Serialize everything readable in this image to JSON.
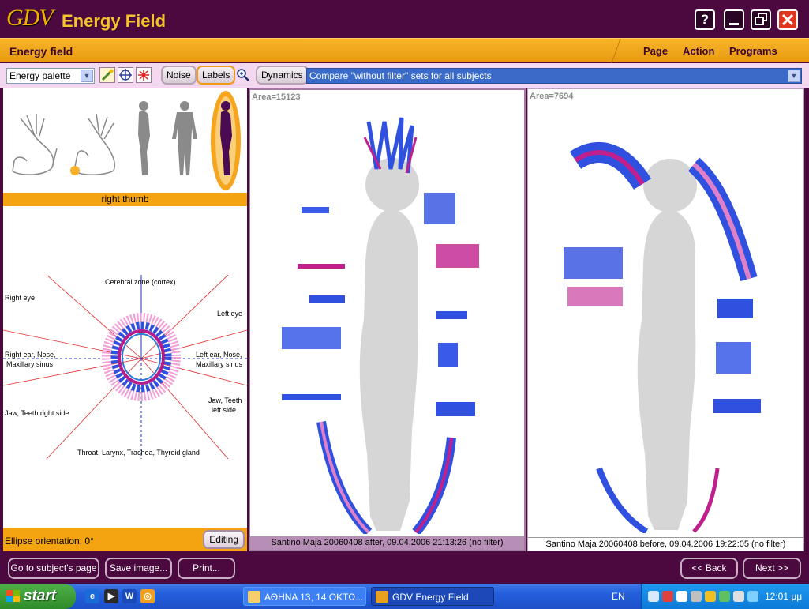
{
  "window": {
    "logo": "GDV",
    "title": "Energy Field",
    "help_label": "?",
    "colors": {
      "frame": "#4b0940",
      "accent": "#f5a411",
      "close": "#e0361e"
    }
  },
  "menubar": {
    "section_title": "Energy field",
    "items": [
      "Page",
      "Action",
      "Programs"
    ]
  },
  "toolbar": {
    "palette_value": "Energy palette",
    "noise_label": "Noise",
    "labels_label": "Labels",
    "dynamics_label": "Dynamics",
    "compare_value": "Compare \"without filter\" sets for all subjects",
    "icons": [
      "palette-icon",
      "crosshair-icon",
      "asterisk-icon",
      "zoom-icon"
    ]
  },
  "left_panel": {
    "selected_part": "right thumb",
    "figure_icons": [
      "left-hand-icon",
      "right-hand-icon",
      "body-side-icon",
      "body-front-icon",
      "body-side-highlighted-icon"
    ],
    "sectors": {
      "top": "Cerebral zone (cortex)",
      "right_eye": "Right eye",
      "left_eye": "Left eye",
      "right_ear_1": "Right ear, Nose,",
      "right_ear_2": "Maxillary sinus",
      "left_ear_1": "Left ear, Nose,",
      "left_ear_2": "Maxillary sinus",
      "jaw_right": "Jaw, Teeth right side",
      "jaw_left_1": "Jaw, Teeth",
      "jaw_left_2": "left side",
      "bottom": "Throat, Larynx, Trachea, Thyroid gland"
    },
    "ellipse_label": "Ellipse orientation: 0°",
    "editing_label": "Editing"
  },
  "views": [
    {
      "area": "Area=15123",
      "caption": "Santino Maja 20060408 after, 09.04.2006 21:13:26 (no filter)"
    },
    {
      "area": "Area=7694",
      "caption": "Santino Maja 20060408 before, 09.04.2006 19:22:05 (no filter)"
    }
  ],
  "bottom_buttons": {
    "subject": "Go to subject's page",
    "save": "Save image...",
    "print": "Print...",
    "back": "<< Back",
    "next": "Next >>"
  },
  "taskbar": {
    "start": "start",
    "task1": "ΑΘΗΝΑ 13, 14 ΟΚΤΩ...",
    "task2": "GDV Energy Field",
    "lang": "EN",
    "clock": "12:01 μμ"
  }
}
